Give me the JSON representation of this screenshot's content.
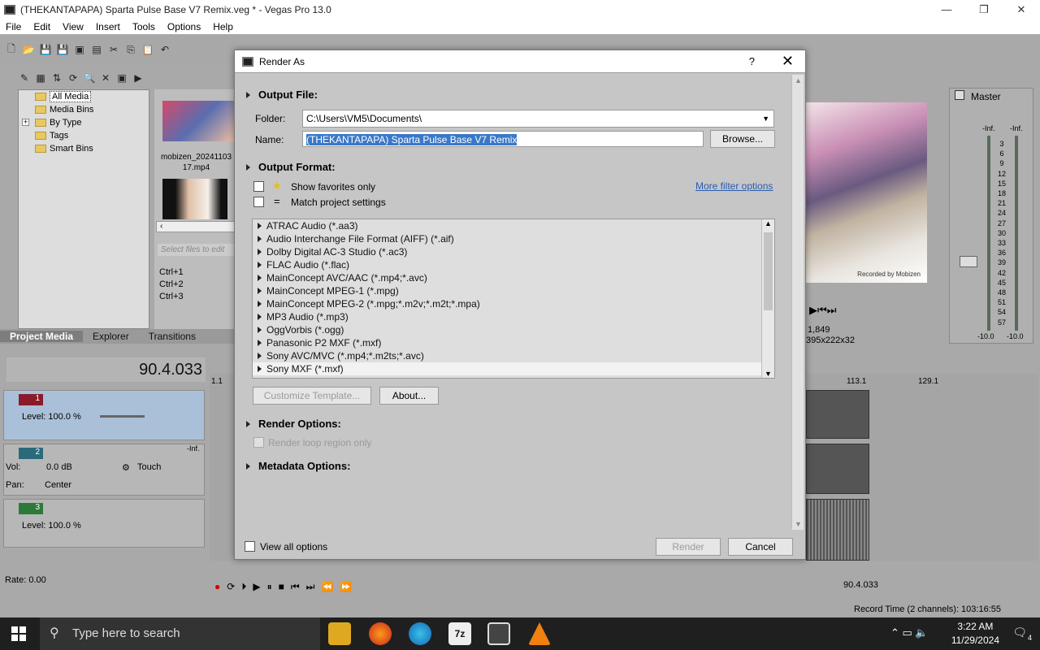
{
  "window": {
    "title": "(THEKANTAPAPA) Sparta Pulse Base V7 Remix.veg * - Vegas Pro 13.0"
  },
  "menu": [
    "File",
    "Edit",
    "View",
    "Insert",
    "Tools",
    "Options",
    "Help"
  ],
  "explorer": {
    "tree": [
      {
        "label": "All Media",
        "selected": true
      },
      {
        "label": "Media Bins"
      },
      {
        "label": "By Type",
        "expandable": true
      },
      {
        "label": "Tags"
      },
      {
        "label": "Smart Bins"
      }
    ],
    "media_file": "mobizen_20241103_17.mp4",
    "media_file_line1": "mobizen_20241103",
    "media_file_line2": "17.mp4",
    "search_placeholder": "Select files to edit",
    "shortcuts": [
      "Ctrl+1",
      "Ctrl+2",
      "Ctrl+3"
    ],
    "tabs": [
      "Project Media",
      "Explorer",
      "Transitions"
    ]
  },
  "timeline": {
    "timecode": "90.4.033",
    "ruler_start": "1.1",
    "ruler_marks": [
      "113.1",
      "129.1"
    ],
    "tracks": [
      {
        "num": "1",
        "level_label": "Level: 100.0 %"
      },
      {
        "num": "2",
        "vol_label": "Vol:",
        "vol_value": "0.0 dB",
        "pan_label": "Pan:",
        "pan_value": "Center",
        "mode": "Touch",
        "meter_top": "-Inf."
      },
      {
        "num": "3",
        "level_label": "Level: 100.0 %"
      }
    ],
    "rate_label": "Rate: 0.00",
    "cursor_time": "90.4.033",
    "record_time": "Record Time (2 channels): 103:16:55"
  },
  "preview": {
    "frame": "1,849",
    "size": "395x222x32",
    "watermark": "Recorded by Mobizen"
  },
  "master": {
    "label": "Master",
    "inf_left": "-Inf.",
    "inf_right": "-Inf.",
    "scale": [
      "3",
      "6",
      "9",
      "12",
      "15",
      "18",
      "21",
      "24",
      "27",
      "30",
      "33",
      "36",
      "39",
      "42",
      "45",
      "48",
      "51",
      "54",
      "57"
    ],
    "bottom_left": "-10.0",
    "bottom_right": "-10.0"
  },
  "dialog": {
    "title": "Render As",
    "help": "?",
    "output_file": {
      "header": "Output File:",
      "folder_label": "Folder:",
      "folder_value": "C:\\Users\\VM5\\Documents\\",
      "name_label": "Name:",
      "name_value": "(THEKANTAPAPA) Sparta Pulse Base V7 Remix",
      "browse": "Browse..."
    },
    "output_format": {
      "header": "Output Format:",
      "favorites": "Show favorites only",
      "match": "Match project settings",
      "more_filters": "More filter options",
      "formats": [
        "ATRAC Audio (*.aa3)",
        "Audio Interchange File Format (AIFF) (*.aif)",
        "Dolby Digital AC-3 Studio (*.ac3)",
        "FLAC Audio (*.flac)",
        "MainConcept AVC/AAC (*.mp4;*.avc)",
        "MainConcept MPEG-1 (*.mpg)",
        "MainConcept MPEG-2 (*.mpg;*.m2v;*.m2t;*.mpa)",
        "MP3 Audio (*.mp3)",
        "OggVorbis (*.ogg)",
        "Panasonic P2 MXF (*.mxf)",
        "Sony AVC/MVC (*.mp4;*.m2ts;*.avc)",
        "Sony MXF (*.mxf)"
      ],
      "selected_index": 11,
      "customize": "Customize Template...",
      "about": "About..."
    },
    "render_options": {
      "header": "Render Options:",
      "loop": "Render loop region only"
    },
    "metadata": {
      "header": "Metadata Options:"
    },
    "view_all": "View all options",
    "render": "Render",
    "cancel": "Cancel"
  },
  "taskbar": {
    "search": "Type here to search",
    "time": "3:22 AM",
    "date": "11/29/2024",
    "notif": "4"
  }
}
